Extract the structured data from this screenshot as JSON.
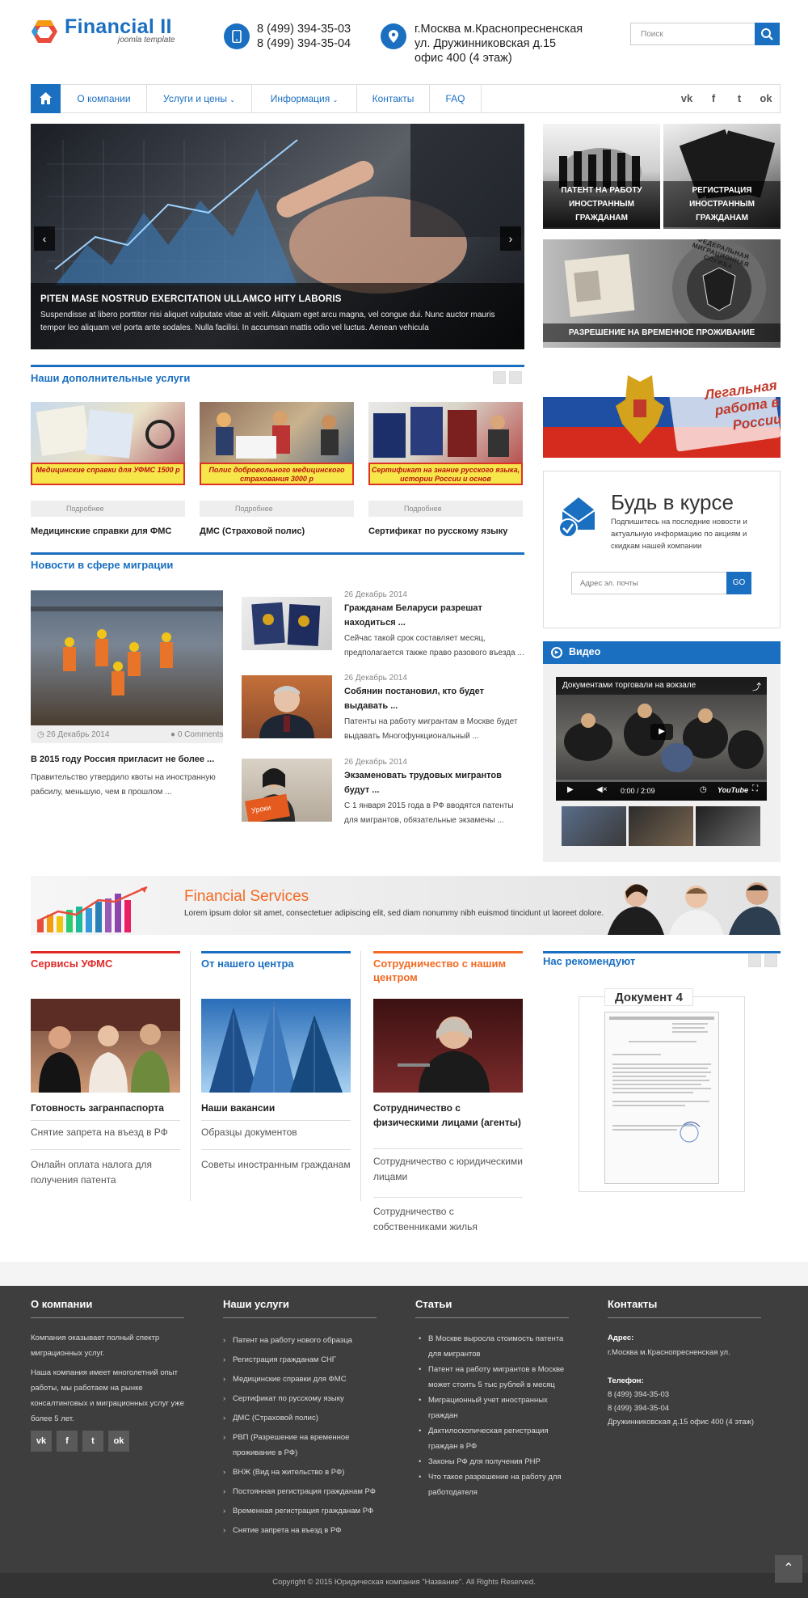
{
  "header": {
    "logo_name": "Financial II",
    "logo_sub": "joomla template",
    "phone1": "8 (499) 394-35-03",
    "phone2": "8 (499) 394-35-04",
    "address1": "г.Москва м.Краснопресненская",
    "address2": "ул. Дружинниковская д.15",
    "address3": "офис 400 (4 этаж)",
    "search_placeholder": "Поиск",
    "accent": "#1a6fc0"
  },
  "nav": {
    "items": [
      "О компании",
      "Услуги и цены",
      "Информация",
      "Контакты",
      "FAQ"
    ],
    "social": [
      "vk",
      "f",
      "t",
      "ok"
    ]
  },
  "slider": {
    "title": "PITEN MASE NOSTRUD EXERCITATION ULLAMCO HITY LABORIS",
    "text": "Suspendisse at libero porttitor nisi aliquet vulputate vitae at velit. Aliquam eget arcu magna, vel congue dui. Nunc auctor mauris tempor leo aliquam vel porta ante sodales. Nulla facilisi. In accumsan mattis odio vel luctus. Aenean vehicula"
  },
  "tiles": {
    "patent": "ПАТЕНТ НА РАБОТУ ИНОСТРАННЫМ ГРАЖДАНАМ",
    "reg": "РЕГИСТРАЦИЯ ИНОСТРАННЫМ ГРАЖДАНАМ",
    "rvp": "РАЗРЕШЕНИЕ НА ВРЕМЕННОЕ ПРОЖИВАНИЕ",
    "fms_ring": "ФЕДЕРАЛЬНАЯ МИГРАЦИОННАЯ СЛУЖБА",
    "legal": "Легальная работа в России"
  },
  "services": {
    "heading": "Наши дополнительные услуги",
    "more": "Подробнее",
    "items": [
      {
        "band": "Медицинские справки для УФМС 1500 р",
        "title": "Медицинские справки для ФМС"
      },
      {
        "band": "Полис добровольного медицинского страхования 3000 р",
        "title": "ДМС (Страховой полис)"
      },
      {
        "band": "Сертификат на знание русского языка, истории России и основ законодательства",
        "title": "Сертификат по русскому языку"
      }
    ]
  },
  "news": {
    "heading": "Новости в сфере миграции",
    "main": {
      "date": "26 Декабрь 2014",
      "comments": "0 Comments",
      "title": "В 2015 году Россия пригласит не более ...",
      "text": "Правительство утвердило квоты на иностранную рабсилу, меньшую, чем в прошлом ..."
    },
    "items": [
      {
        "date": "26 Декабрь 2014",
        "title": "Гражданам Беларуси разрешат находиться ...",
        "text": "Сейчас такой срок составляет месяц, предполагается также право разового въезда ..."
      },
      {
        "date": "26 Декабрь 2014",
        "title": "Собянин постановил, кто будет выдавать ...",
        "text": "Патенты на работу мигрантам в Москве будет выдавать Многофункциональный ..."
      },
      {
        "date": "26 Декабрь 2014",
        "title": "Экзаменовать трудовых мигрантов будут ...",
        "text": "С 1 января 2015 года в РФ вводятся патенты для мигрантов, обязательные экзамены ..."
      }
    ]
  },
  "subscribe": {
    "title": "Будь в курсе",
    "text": "Подпишитесь на последние новости и актуальную информацию по акциям и скидкам нашей компании",
    "placeholder": "Адрес эл. почты",
    "button": "GO"
  },
  "video": {
    "heading": "Видео",
    "title": "Документами торговали на вокзале",
    "time": "0:00 / 2:09",
    "yt": "YouTube"
  },
  "banner": {
    "title": "Financial Services",
    "text": "Lorem ipsum dolor sit amet, consectetuer adipiscing elit, sed diam nonummy nibh euismod tincidunt ut laoreet dolore."
  },
  "cols": {
    "col1": {
      "heading": "Сервисы УФМС",
      "bold": "Готовность загранпаспорта",
      "l1": "Снятие запрета на въезд в РФ",
      "l2": "Онлайн оплата налога для получения патента",
      "color": "#e02a2a"
    },
    "col2": {
      "heading": "От нашего центра",
      "bold": "Наши вакансии",
      "l1": "Образцы документов",
      "l2": "Советы иностранным гражданам",
      "color": "#1a6fc0"
    },
    "col3": {
      "heading": "Сотрудничество с нашим центром",
      "bold": "Сотрудничество с физическими лицами (агенты)",
      "l1": "Сотрудничество с юридическими лицами",
      "l2": "Сотрудничество с собственниками жилья",
      "color": "#f26a23"
    },
    "recommend": {
      "heading": "Нас рекомендуют",
      "doc": "Документ 4"
    }
  },
  "footer": {
    "about": {
      "heading": "О компании",
      "p1": "Компания оказывает полный спектр миграционных услуг.",
      "p2": "Наша компания имеет многолетний опыт работы, мы работаем на рынке консалтинговых и миграционных услуг уже более 5 лет."
    },
    "services": {
      "heading": "Наши услуги",
      "items": [
        "Патент на работу нового образца",
        "Регистрация гражданам СНГ",
        "Медицинские справки для ФМС",
        "Сертификат по русскому языку",
        "ДМС (Страховой полис)",
        "РВП (Разрешение на временное проживание в РФ)",
        "ВНЖ (Вид на жительство в РФ)",
        "Постоянная регистрация гражданам РФ",
        "Временная регистрация гражданам РФ",
        "Снятие запрета на въезд в РФ"
      ]
    },
    "articles": {
      "heading": "Статьи",
      "items": [
        "В Москве выросла стоимость патента для мигрантов",
        "Патент на работу мигрантов в Москве может стоить 5 тыс рублей в месяц",
        "Миграционный учет иностранных граждан",
        "Дактилоскопическая регистрация граждан в РФ",
        "Законы РФ для получения РНР",
        "Что такое разрешение на работу для работодателя"
      ]
    },
    "contacts": {
      "heading": "Контакты",
      "addr_label": "Адрес:",
      "addr": "г.Москва м.Краснопресненская ул.",
      "tel_label": "Телефон:",
      "tel1": "8 (499) 394-35-03",
      "tel2": "8 (499) 394-35-04",
      "office": "Дружинниковская д.15 офис 400 (4 этаж)"
    },
    "copyright": "Copyright © 2015 Юридическая компания \"Название\". All Rights Reserved."
  }
}
